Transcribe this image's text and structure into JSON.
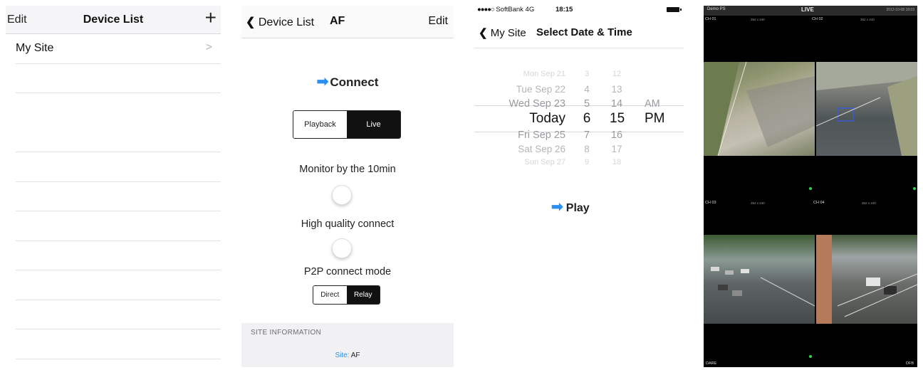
{
  "device_list": {
    "edit": "Edit",
    "title": "Device List",
    "add": "+",
    "items": [
      {
        "label": "My Site"
      }
    ]
  },
  "device_af": {
    "back": "Device List",
    "title": "AF",
    "edit": "Edit",
    "connect": "Connect",
    "mode": {
      "playback": "Playback",
      "live": "Live",
      "selected": "Live"
    },
    "monitor_label": "Monitor by the 10min",
    "monitor_on": false,
    "hq_label": "High quality connect",
    "hq_on": false,
    "p2p_label": "P2P connect mode",
    "p2p": {
      "direct": "Direct",
      "relay": "Relay",
      "selected": "Relay"
    },
    "site_info_caption": "SITE INFORMATION",
    "site_key": "Site:",
    "site_value": "AF"
  },
  "date_time": {
    "status": {
      "carrier": "SoftBank",
      "network": "4G",
      "time": "18:15"
    },
    "back": "My Site",
    "title": "Select Date & Time",
    "days": [
      "Mon Sep 21",
      "Tue Sep 22",
      "Wed Sep 23",
      "Today",
      "Fri Sep 25",
      "Sat Sep 26",
      "Sun Sep 27"
    ],
    "hours": [
      "3",
      "4",
      "5",
      "6",
      "7",
      "8",
      "9"
    ],
    "minutes": [
      "12",
      "13",
      "14",
      "15",
      "16",
      "17",
      "18"
    ],
    "ampm": [
      "AM",
      "PM"
    ],
    "selected": {
      "day": "Today",
      "hour": "6",
      "minute": "15",
      "ampm": "PM"
    },
    "play": "Play"
  },
  "live_view": {
    "site": "Demo PS",
    "mode": "LIVE",
    "datetime": "2012-10-08 18:03",
    "channels": [
      {
        "label": "CH 01",
        "res": "352 x 240"
      },
      {
        "label": "CH 02",
        "res": "352 x 240"
      },
      {
        "label": "CH 03",
        "res": "352 x 240"
      },
      {
        "label": "CH 04",
        "res": "352 x 240"
      }
    ],
    "bottom_left": "DARE",
    "bottom_right": "DFB"
  }
}
